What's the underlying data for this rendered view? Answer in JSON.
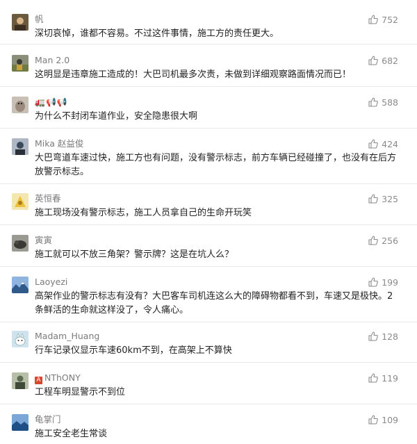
{
  "comments": [
    {
      "name": "帆",
      "text": "深切哀悼，谁都不容易。不过这件事情，施工方的责任更大。",
      "likes": "752",
      "avatar_icon": "avatar-portrait",
      "avatar_color": "#6b5a3e"
    },
    {
      "name": "Man 2.0",
      "text": "这明显是违章施工造成的！大巴司机最多次责，未做到详细观察路面情况而已！",
      "likes": "682",
      "avatar_icon": "avatar-portrait",
      "avatar_color": "#8a8f7a"
    },
    {
      "name": "🚛📢📢",
      "text": "为什么不封闭车道作业，安全隐患很大啊",
      "likes": "588",
      "avatar_icon": "avatar-animal",
      "avatar_color": "#9b8b7e"
    },
    {
      "name": "Mika 赵益俊",
      "text": "大巴弯道车速过快，施工方也有问题，没有警示标志，前方车辆已经碰撞了，也没有在后方放警示标志。",
      "likes": "424",
      "avatar_icon": "avatar-portrait",
      "avatar_color": "#3b4a5c"
    },
    {
      "name": "英恒春",
      "text": "施工现场没有警示标志，施工人员拿自己的生命开玩笑",
      "likes": "325",
      "avatar_icon": "avatar-cartoon",
      "avatar_color": "#e8c23a"
    },
    {
      "name": "寅寅",
      "text": "施工就可以不放三角架？警示牌？这是在坑人么？",
      "likes": "256",
      "avatar_icon": "avatar-animal",
      "avatar_color": "#4a4a44"
    },
    {
      "name": "Laoyezi",
      "text": "高架作业的警示标志有没有？大巴客车司机连这么大的障碍物都看不到，车速又是极快。2条鲜活的生命就这样没了，令人痛心。",
      "likes": "199",
      "avatar_icon": "avatar-landscape",
      "avatar_color": "#5a7fb0"
    },
    {
      "name": "Madam_Huang",
      "text": "行车记录仪显示车速60km不到，在高架上不算快",
      "likes": "128",
      "avatar_icon": "avatar-cartoon",
      "avatar_color": "#cfe3ee"
    },
    {
      "name": "NThONY",
      "badge": "A",
      "text": "工程车明显警示不到位",
      "likes": "119",
      "avatar_icon": "avatar-portrait",
      "avatar_color": "#5d6b52"
    },
    {
      "name": "龟掌门",
      "text": "施工安全老生常谈",
      "likes": "109",
      "avatar_icon": "avatar-landscape",
      "avatar_color": "#3a6fa8"
    }
  ]
}
